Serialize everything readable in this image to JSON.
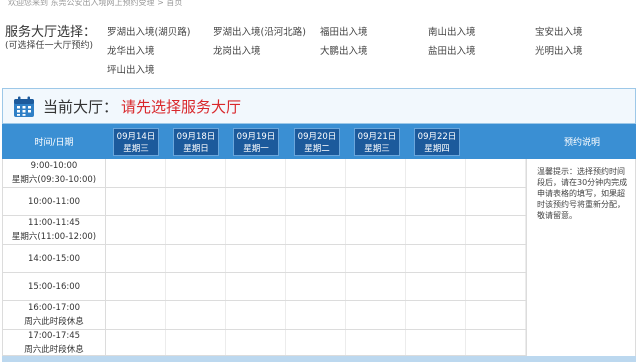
{
  "top_notice": "欢迎您来到 东莞公安出入境网上预约受理  > 首页",
  "hall_select": {
    "title": "服务大厅选择：",
    "subtitle": "(可选择任一大厅预约)",
    "options": [
      "罗湖出入境(湖贝路)",
      "罗湖出入境(沿河北路)",
      "福田出入境",
      "南山出入境",
      "宝安出入境",
      "龙华出入境",
      "龙岗出入境",
      "大鹏出入境",
      "盐田出入境",
      "光明出入境",
      "坪山出入境"
    ]
  },
  "current_hall": {
    "label": "当前大厅：",
    "value": "请先选择服务大厅"
  },
  "table": {
    "time_header": "时间/日期",
    "notes_header": "预约说明",
    "dates": [
      {
        "date": "09月14日",
        "weekday": "星期三"
      },
      {
        "date": "09月18日",
        "weekday": "星期日"
      },
      {
        "date": "09月19日",
        "weekday": "星期一"
      },
      {
        "date": "09月20日",
        "weekday": "星期二"
      },
      {
        "date": "09月21日",
        "weekday": "星期三"
      },
      {
        "date": "09月22日",
        "weekday": "星期四"
      }
    ],
    "rows": [
      {
        "line1": "9:00-10:00",
        "line2": "星期六(09:30-10:00)"
      },
      {
        "line1": "10:00-11:00",
        "line2": ""
      },
      {
        "line1": "11:00-11:45",
        "line2": "星期六(11:00-12:00)"
      },
      {
        "line1": "14:00-15:00",
        "line2": ""
      },
      {
        "line1": "15:00-16:00",
        "line2": ""
      },
      {
        "line1": "16:00-17:00",
        "line2": "周六此时段休息"
      },
      {
        "line1": "17:00-17:45",
        "line2": "周六此时段休息"
      }
    ],
    "notes_text": "温馨提示：选择预约时间段后，请在30分钟内完成申请表格的填写，如果超时该预约号将重新分配，敬请留意。"
  },
  "colors": {
    "header_blue": "#3a8fd3",
    "date_tab_blue": "#1c5a9c",
    "alert_red": "#d9282c"
  }
}
